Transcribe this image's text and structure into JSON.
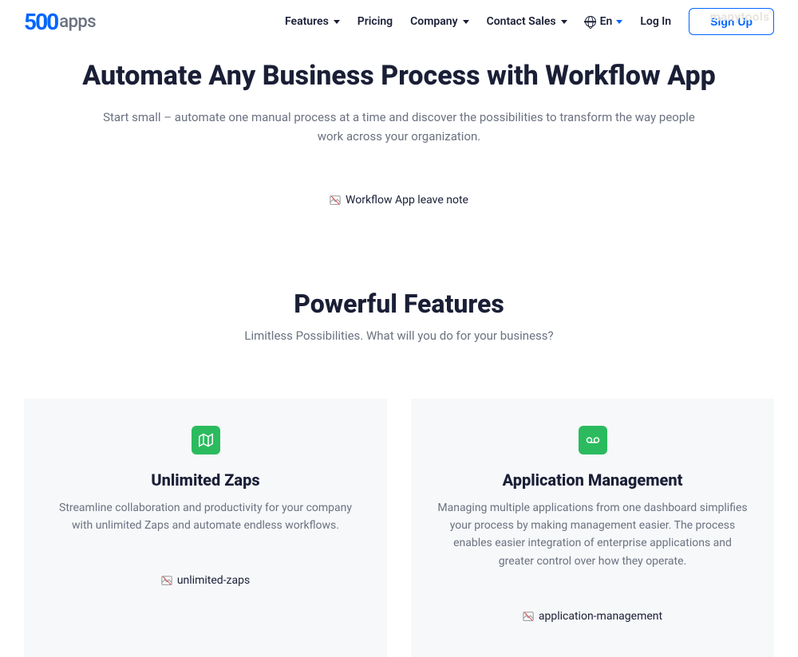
{
  "watermark": "manytools",
  "logo": {
    "prefix": "500",
    "suffix": "apps"
  },
  "nav": {
    "features": "Features",
    "pricing": "Pricing",
    "company": "Company",
    "contact": "Contact Sales",
    "lang": "En",
    "login": "Log In",
    "signup": "Sign Up"
  },
  "hero": {
    "title": "Automate Any Business Process with Workflow App",
    "subtitle": "Start small – automate one manual process at a time and discover the possibilities to transform the way people work across your organization.",
    "brokenAlt": "Workflow App leave note"
  },
  "features": {
    "title": "Powerful Features",
    "subtitle": "Limitless Possibilities. What will you do for your business?",
    "cards": [
      {
        "icon": "map-icon",
        "title": "Unlimited Zaps",
        "desc": "Streamline collaboration and productivity for your company with unlimited Zaps and automate endless workflows.",
        "brokenAlt": "unlimited-zaps"
      },
      {
        "icon": "voicemail-icon",
        "title": "Application Management",
        "desc": "Managing multiple applications from one dashboard simplifies your process by making management easier. The process enables easier integration of enterprise applications and greater control over how they operate.",
        "brokenAlt": "application-management"
      }
    ]
  }
}
